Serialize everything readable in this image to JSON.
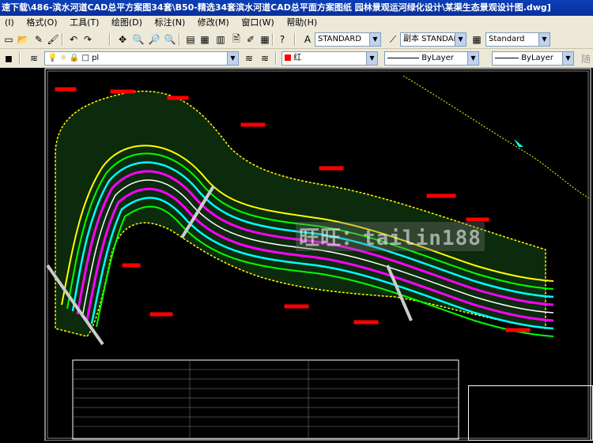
{
  "titlebar": {
    "text": "速下载\\486-滨水河道CAD总平方案图34套\\B50-精选34套滨水河道CAD总平面方案图纸 园林景观运河绿化设计\\某渠生态景观设计图.dwg]"
  },
  "menu": {
    "items": [
      "(I)",
      "格式(O)",
      "工具(T)",
      "绘图(D)",
      "标注(N)",
      "修改(M)",
      "窗口(W)",
      "帮助(H)"
    ]
  },
  "toolbar1": {
    "text_style": "STANDARD",
    "dim_style": "副本 STANDARI",
    "table_style": "Standard"
  },
  "toolbar2": {
    "layer_name": "pl",
    "color_name": "红",
    "linetype": "ByLayer",
    "lineweight": "ByLayer",
    "truncated_label": "随"
  },
  "watermark": {
    "text": "旺旺：tailin188"
  },
  "colors": {
    "titlebar": "#0a3fb8",
    "chrome": "#ece9d8",
    "canvas": "#000000",
    "river_magenta": "#ff00ff",
    "river_cyan": "#00ffff",
    "bank_yellow": "#ffff00",
    "bank_green": "#00ff00",
    "label_red": "#ff0000"
  }
}
